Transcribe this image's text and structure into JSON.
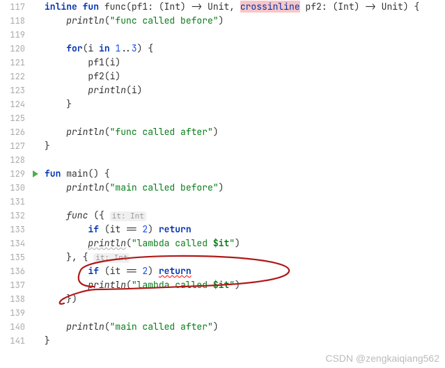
{
  "lines": [
    {
      "num": "117",
      "indent": 0,
      "segments": [
        {
          "t": "kw",
          "v": "inline fun "
        },
        {
          "t": "plain",
          "v": "func(pf1: (Int) -> Unit, "
        },
        {
          "t": "hl",
          "v": "crossinline"
        },
        {
          "t": "plain",
          "v": " pf2: (Int) -> Unit) {"
        }
      ]
    },
    {
      "num": "118",
      "indent": 1,
      "segments": [
        {
          "t": "fn",
          "v": "println"
        },
        {
          "t": "plain",
          "v": "("
        },
        {
          "t": "str",
          "v": "\"func called before\""
        },
        {
          "t": "plain",
          "v": ")"
        }
      ]
    },
    {
      "num": "119",
      "indent": 0,
      "segments": []
    },
    {
      "num": "120",
      "indent": 1,
      "segments": [
        {
          "t": "kw",
          "v": "for"
        },
        {
          "t": "plain",
          "v": "(i "
        },
        {
          "t": "kw",
          "v": "in"
        },
        {
          "t": "plain",
          "v": " "
        },
        {
          "t": "num",
          "v": "1"
        },
        {
          "t": "plain",
          "v": ".."
        },
        {
          "t": "num",
          "v": "3"
        },
        {
          "t": "plain",
          "v": ") {"
        }
      ]
    },
    {
      "num": "121",
      "indent": 2,
      "segments": [
        {
          "t": "plain",
          "v": "pf1(i)"
        }
      ]
    },
    {
      "num": "122",
      "indent": 2,
      "segments": [
        {
          "t": "plain",
          "v": "pf2(i)"
        }
      ]
    },
    {
      "num": "123",
      "indent": 2,
      "segments": [
        {
          "t": "fn",
          "v": "println"
        },
        {
          "t": "plain",
          "v": "(i)"
        }
      ]
    },
    {
      "num": "124",
      "indent": 1,
      "segments": [
        {
          "t": "plain",
          "v": "}"
        }
      ]
    },
    {
      "num": "125",
      "indent": 0,
      "segments": []
    },
    {
      "num": "126",
      "indent": 1,
      "segments": [
        {
          "t": "fn",
          "v": "println"
        },
        {
          "t": "plain",
          "v": "("
        },
        {
          "t": "str",
          "v": "\"func called after\""
        },
        {
          "t": "plain",
          "v": ")"
        }
      ]
    },
    {
      "num": "127",
      "indent": 0,
      "segments": [
        {
          "t": "plain",
          "v": "}"
        }
      ]
    },
    {
      "num": "128",
      "indent": 0,
      "segments": []
    },
    {
      "num": "129",
      "indent": 0,
      "run": true,
      "segments": [
        {
          "t": "kw",
          "v": "fun "
        },
        {
          "t": "plain",
          "v": "main() {"
        }
      ]
    },
    {
      "num": "130",
      "indent": 1,
      "segments": [
        {
          "t": "fn",
          "v": "println"
        },
        {
          "t": "plain",
          "v": "("
        },
        {
          "t": "str",
          "v": "\"main called before\""
        },
        {
          "t": "plain",
          "v": ")"
        }
      ]
    },
    {
      "num": "131",
      "indent": 0,
      "segments": []
    },
    {
      "num": "132",
      "indent": 1,
      "segments": [
        {
          "t": "fn",
          "v": "func "
        },
        {
          "t": "plain",
          "v": "({ "
        },
        {
          "t": "hint",
          "v": "it: Int"
        }
      ]
    },
    {
      "num": "133",
      "indent": 2,
      "segments": [
        {
          "t": "kw",
          "v": "if"
        },
        {
          "t": "plain",
          "v": " (it == "
        },
        {
          "t": "num",
          "v": "2"
        },
        {
          "t": "plain",
          "v": ") "
        },
        {
          "t": "kw",
          "v": "return"
        }
      ]
    },
    {
      "num": "134",
      "indent": 2,
      "segments": [
        {
          "t": "fnwavy",
          "v": "println"
        },
        {
          "t": "plain",
          "v": "("
        },
        {
          "t": "str",
          "v": "\"lambda called "
        },
        {
          "t": "strvar",
          "v": "$it"
        },
        {
          "t": "str",
          "v": "\""
        },
        {
          "t": "plain",
          "v": ")"
        }
      ]
    },
    {
      "num": "135",
      "indent": 1,
      "segments": [
        {
          "t": "plain",
          "v": "}, { "
        },
        {
          "t": "hint",
          "v": "it: Int"
        }
      ]
    },
    {
      "num": "136",
      "indent": 2,
      "segments": [
        {
          "t": "kw",
          "v": "if"
        },
        {
          "t": "plain",
          "v": " (it == "
        },
        {
          "t": "num",
          "v": "2"
        },
        {
          "t": "plain",
          "v": ") "
        },
        {
          "t": "kwwavy",
          "v": "return"
        }
      ]
    },
    {
      "num": "137",
      "indent": 2,
      "segments": [
        {
          "t": "fn",
          "v": "println"
        },
        {
          "t": "plain",
          "v": "("
        },
        {
          "t": "str",
          "v": "\"lambda called "
        },
        {
          "t": "strvar",
          "v": "$it"
        },
        {
          "t": "str",
          "v": "\""
        },
        {
          "t": "plain",
          "v": ")"
        }
      ]
    },
    {
      "num": "138",
      "indent": 1,
      "segments": [
        {
          "t": "plain",
          "v": "})"
        }
      ]
    },
    {
      "num": "139",
      "indent": 0,
      "segments": []
    },
    {
      "num": "140",
      "indent": 1,
      "segments": [
        {
          "t": "fn",
          "v": "println"
        },
        {
          "t": "plain",
          "v": "("
        },
        {
          "t": "str",
          "v": "\"main called after\""
        },
        {
          "t": "plain",
          "v": ")"
        }
      ]
    },
    {
      "num": "141",
      "indent": 0,
      "segments": [
        {
          "t": "plain",
          "v": "}"
        }
      ]
    }
  ],
  "watermark": "CSDN @zengkaiqiang562"
}
